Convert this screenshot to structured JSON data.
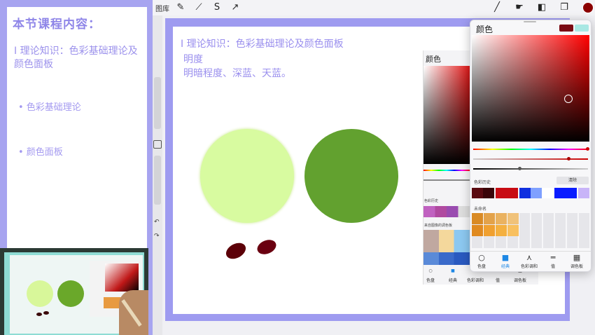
{
  "lesson": {
    "title": "本节课程内容：",
    "topic": "I 理论知识：色彩基础理论及颜色面板",
    "items": [
      "• 色彩基础理论",
      "• 颜色面板"
    ]
  },
  "toolbar": {
    "gallery_label": "图库",
    "tools": [
      "wrench-icon",
      "magic-wand-icon",
      "selection-icon",
      "transform-icon"
    ],
    "right_tools": [
      "brush-icon",
      "smudge-icon",
      "eraser-icon",
      "layers-icon"
    ],
    "current_color": "#8b0000"
  },
  "canvas": {
    "heading": "I 理论知识：色彩基础理论及颜色面板",
    "line1": "明度",
    "line2": "明暗程度、深蓝、天蓝。",
    "circle_light_color": "#d8fba0",
    "circle_dark_color": "#62a12f",
    "blob_color": "#5c0008"
  },
  "old_panel": {
    "title": "颜色",
    "history_label": "色彩历史",
    "palette_label": "来自图像的调色板",
    "tabs": [
      "色盘",
      "经典",
      "色彩调和",
      "值",
      "调色板"
    ]
  },
  "color_panel": {
    "title": "颜色",
    "current": "#7a0a14",
    "previous": "#a9e8e4",
    "history_label": "色彩历史",
    "clear_label": "清除",
    "palette_label": "未命名",
    "history": [
      "#5a0a10",
      "#3a0408",
      "#c80c14",
      "#c80c14",
      "#1030e0",
      "#7fa0ff",
      "#ffffff",
      "#0a1cff",
      "#0a1cff",
      "#c8b4f8"
    ],
    "palette": [
      "#d98a24",
      "#e3a24a",
      "#eab260",
      "#f0c27a",
      "#e08a20",
      "#f0a030",
      "#f4b040",
      "#f8c060"
    ],
    "tabs": [
      "色盘",
      "经典",
      "色彩调和",
      "值",
      "调色板"
    ]
  }
}
